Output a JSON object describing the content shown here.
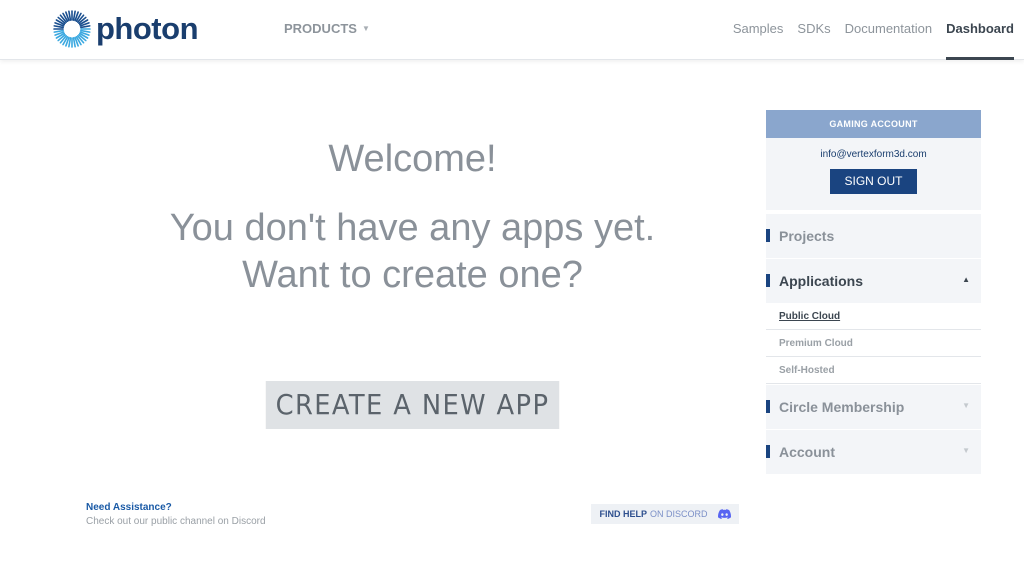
{
  "header": {
    "logo_text": "photon",
    "products_label": "PRODUCTS",
    "nav": [
      "Samples",
      "SDKs",
      "Documentation",
      "Dashboard"
    ]
  },
  "main": {
    "welcome": "Welcome!",
    "line1": "You don't have any apps yet.",
    "line2": "Want to create one?",
    "create_button": "CREATE A NEW APP"
  },
  "assist": {
    "title": "Need Assistance?",
    "subtitle": "Check out our public channel on Discord",
    "button_bold": "FIND HELP",
    "button_light": "ON DISCORD"
  },
  "sidebar": {
    "account_header": "GAMING ACCOUNT",
    "email": "info@vertexform3d.com",
    "signout": "SIGN OUT",
    "projects": "Projects",
    "applications": "Applications",
    "app_items": [
      "Public Cloud",
      "Premium Cloud",
      "Self-Hosted"
    ],
    "circle": "Circle Membership",
    "account": "Account"
  },
  "colors": {
    "brand": "#1a3e6e",
    "accent": "#1a4480",
    "account_header": "#8aa6cd"
  }
}
